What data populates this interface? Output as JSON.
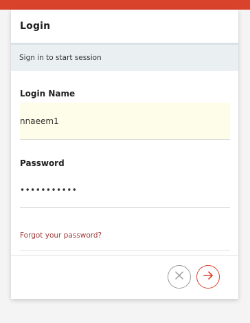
{
  "header": {
    "title": "Login"
  },
  "subheader": {
    "text": "Sign in to start session"
  },
  "form": {
    "login_name_label": "Login Name",
    "login_name_value": "nnaeem1",
    "password_label": "Password",
    "password_value": "•••••••••••",
    "forgot_link": "Forgot your password?"
  },
  "footer": {
    "cancel_icon": "circle-x-icon",
    "submit_icon": "circle-arrow-right-icon"
  },
  "colors": {
    "accent": "#d9432b",
    "link": "#a13c3c",
    "input_fill": "#fefde9",
    "subheader_bg": "#eaf0f2"
  }
}
